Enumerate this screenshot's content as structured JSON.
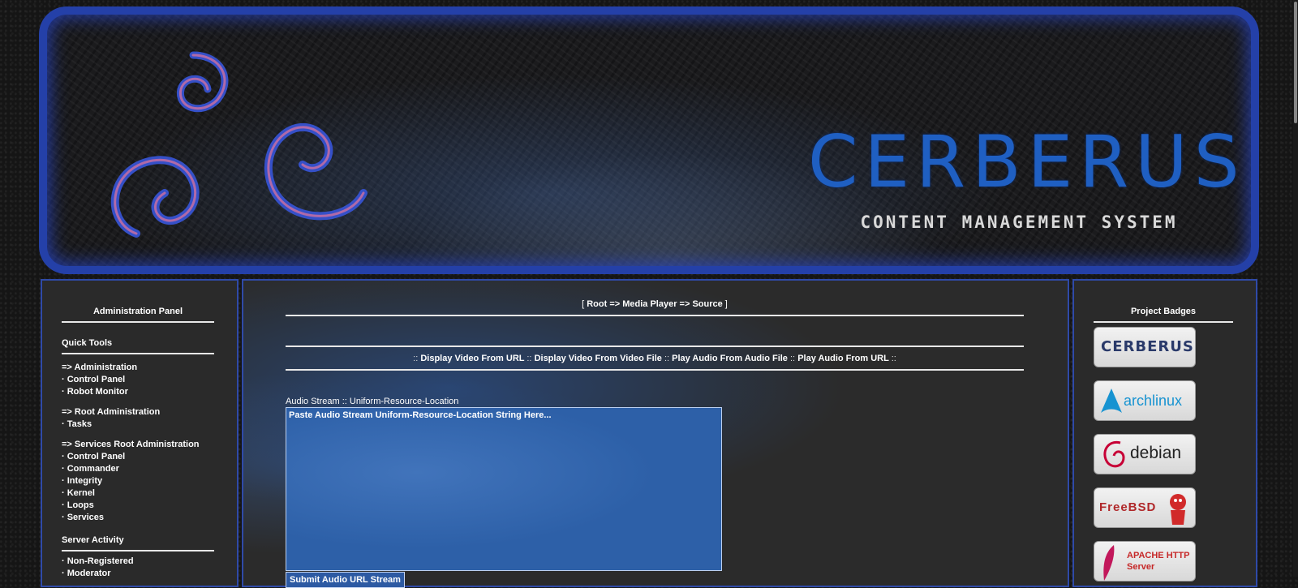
{
  "banner": {
    "logo_title": "CERBERUS",
    "logo_subtitle": "CONTENT MANAGEMENT SYSTEM"
  },
  "left_panel": {
    "title": "Administration Panel",
    "quick_tools": "Quick Tools",
    "groups": [
      {
        "heading": "=> Administration",
        "items": [
          "· Control Panel",
          "· Robot Monitor"
        ]
      },
      {
        "heading": "=> Root Administration",
        "items": [
          "· Tasks"
        ]
      },
      {
        "heading": "=> Services Root Administration",
        "items": [
          "· Control Panel",
          "· Commander",
          "· Integrity",
          "· Kernel",
          "· Loops",
          "· Services"
        ]
      }
    ],
    "server_activity": "Server Activity",
    "activity_items": [
      "· Non-Registered",
      "· Moderator"
    ]
  },
  "main": {
    "breadcrumb": {
      "open": "[ ",
      "path": "Root => Media Player => Source",
      "close": " ]"
    },
    "nav_links": [
      "Display Video From URL",
      "Display Video From Video File",
      "Play Audio From Audio File",
      "Play Audio From URL"
    ],
    "nav_sep": "::",
    "field_label": "Audio Stream :: Uniform-Resource-Location",
    "field_placeholder": "Paste Audio Stream Uniform-Resource-Location String Here...",
    "submit_label": "Submit Audio URL Stream"
  },
  "right_panel": {
    "title": "Project Badges",
    "badges": [
      "CERBERUS",
      "archlinux",
      "debian",
      "FreeBSD",
      "APACHE HTTP Server"
    ]
  },
  "colors": {
    "accent_border": "#2f4aa8",
    "logo_blue": "#1f5fc2",
    "input_blue": "#2d60a8"
  }
}
